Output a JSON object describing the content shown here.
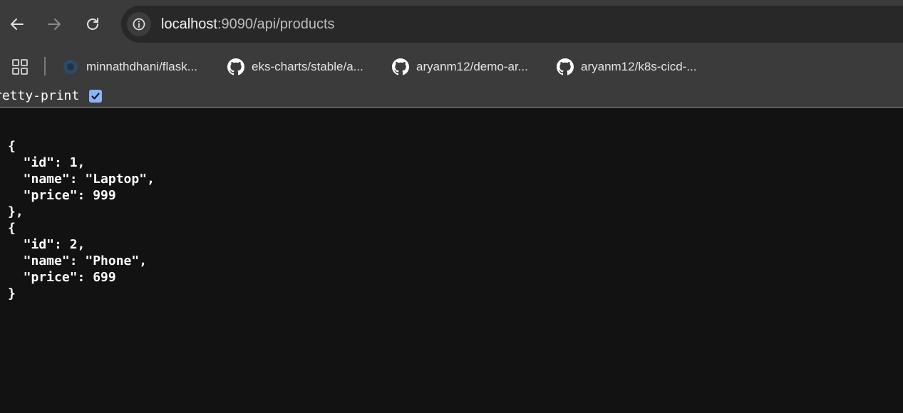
{
  "toolbar": {
    "back_icon": "arrow-left-icon",
    "forward_icon": "arrow-right-icon",
    "reload_icon": "reload-icon",
    "site_info_icon": "info-icon"
  },
  "address_bar": {
    "host": "localhost",
    "rest": ":9090/api/products"
  },
  "bookmarks": [
    {
      "label": "minnathdhani/flask...",
      "icon": "site-favicon"
    },
    {
      "label": "eks-charts/stable/a...",
      "icon": "github-icon"
    },
    {
      "label": "aryanm12/demo-ar...",
      "icon": "github-icon"
    },
    {
      "label": "aryanm12/k8s-cicd-...",
      "icon": "github-icon"
    }
  ],
  "pretty_print": {
    "label": "retty-print",
    "checked": true
  },
  "json_body": "{\n  \"id\": 1,\n  \"name\": \"Laptop\",\n  \"price\": 999\n},\n{\n  \"id\": 2,\n  \"name\": \"Phone\",\n  \"price\": 699\n}",
  "colors": {
    "toolbar_bg": "#3b3b3b",
    "omnibox_bg": "#282828",
    "page_bg": "#121212",
    "checkbox_accent": "#8ab4f8"
  }
}
